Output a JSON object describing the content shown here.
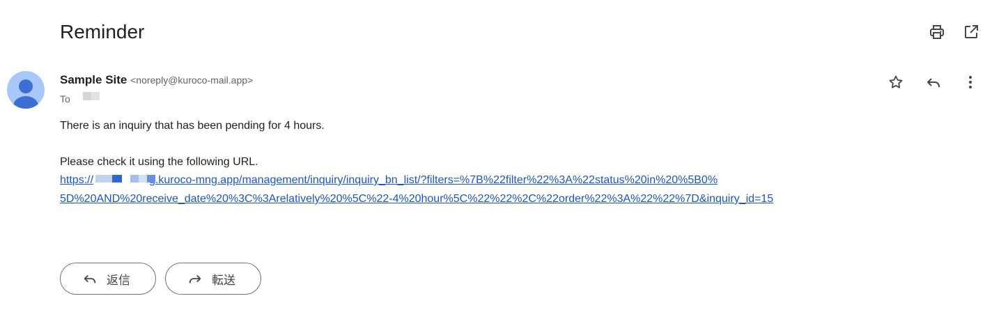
{
  "subject": "Reminder",
  "top_actions": {
    "print_icon": "print-icon",
    "open_new_window_icon": "open-in-new-icon"
  },
  "sender": {
    "name": "Sample Site",
    "email": "<noreply@kuroco-mail.app>",
    "to_label": "To"
  },
  "message_actions": {
    "star_icon": "star-icon",
    "reply_icon": "reply-icon",
    "more_icon": "more-vert-icon"
  },
  "body": {
    "line1": "There is an inquiry that has been pending for 4 hours.",
    "line2": "Please check it using the following URL.",
    "url_prefix": "https://",
    "url_part1": "g.kuroco-mng.app/management/inquiry/inquiry_bn_list/?filters=%7B%22filter%22%3A%22status%20in%20%5B0%",
    "url_part2": "5D%20AND%20receive_date%20%3C%3Arelatively%20%5C%22-4%20hour%5C%22%22%2C%22order%22%3A%22%22%7D&inquiry_id=15"
  },
  "buttons": {
    "reply_label": "返信",
    "forward_label": "転送"
  },
  "colors": {
    "link": "#1a56c7",
    "avatar_bg": "#a8c7fa",
    "avatar_fg": "#3b6fd6"
  }
}
